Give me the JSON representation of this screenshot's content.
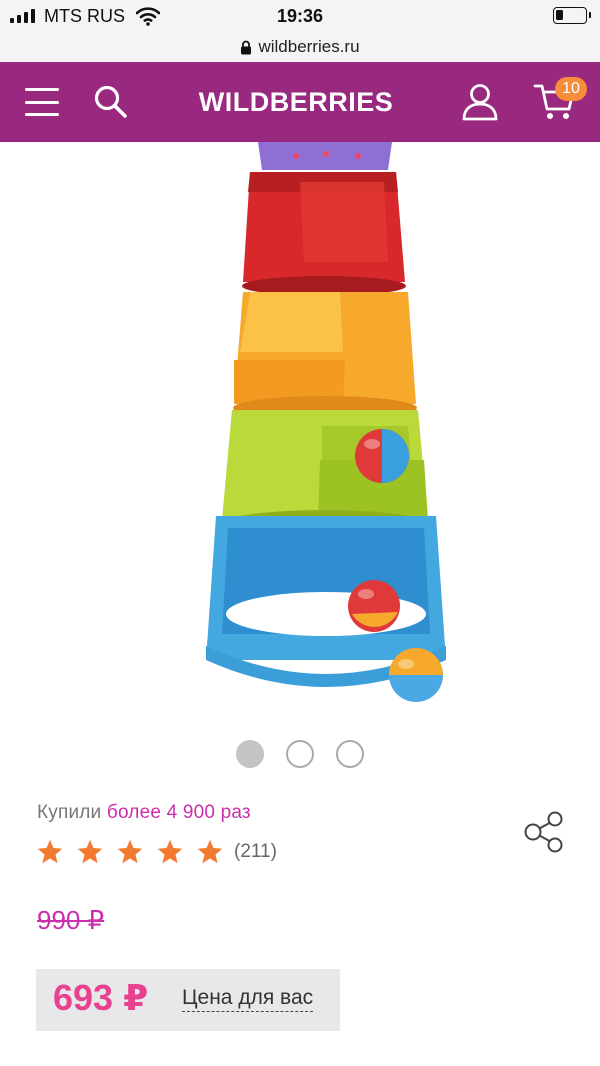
{
  "status_bar": {
    "carrier": "MTS RUS",
    "time": "19:36"
  },
  "browser": {
    "url": "wildberries.ru"
  },
  "header": {
    "logo": "WILDBERRIES",
    "cart_count": "10",
    "brand_color": "#99287f",
    "badge_color": "#f58d3a"
  },
  "gallery": {
    "slides": 3,
    "active_index": 0
  },
  "product": {
    "bought_prefix": "Купили",
    "bought_highlight": "более 4 900 раз",
    "rating": 5,
    "review_count": "(211)",
    "old_price": "990 ₽",
    "price": "693 ₽",
    "price_label": "Цена для вас",
    "accent_color": "#cb2fae",
    "star_color": "#f17a2e"
  }
}
